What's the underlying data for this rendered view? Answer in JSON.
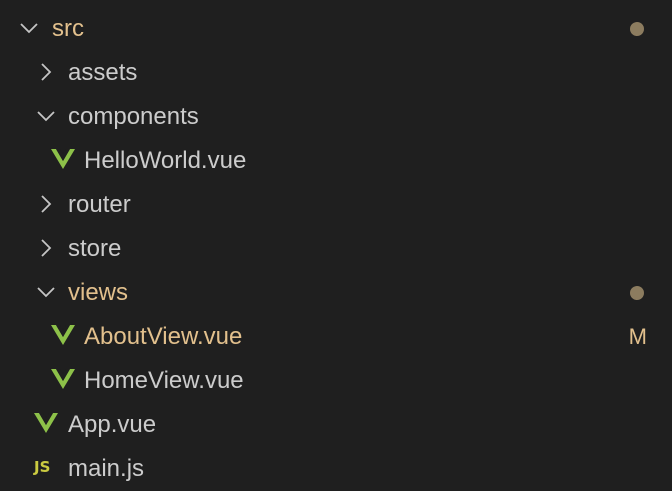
{
  "explorer": {
    "items": [
      {
        "label": "src",
        "kind": "folder",
        "expanded": true,
        "icon": "chevron-down-icon",
        "decoration": "dot"
      },
      {
        "label": "assets",
        "kind": "folder",
        "expanded": false,
        "icon": "chevron-right-icon"
      },
      {
        "label": "components",
        "kind": "folder",
        "expanded": true,
        "icon": "chevron-down-icon"
      },
      {
        "label": "HelloWorld.vue",
        "kind": "file",
        "icon": "vue-file-icon"
      },
      {
        "label": "router",
        "kind": "folder",
        "expanded": false,
        "icon": "chevron-right-icon"
      },
      {
        "label": "store",
        "kind": "folder",
        "expanded": false,
        "icon": "chevron-right-icon"
      },
      {
        "label": "views",
        "kind": "folder",
        "expanded": true,
        "icon": "chevron-down-icon",
        "decoration": "dot"
      },
      {
        "label": "AboutView.vue",
        "kind": "file",
        "icon": "vue-file-icon",
        "badge": "M"
      },
      {
        "label": "HomeView.vue",
        "kind": "file",
        "icon": "vue-file-icon"
      },
      {
        "label": "App.vue",
        "kind": "file",
        "icon": "vue-file-icon"
      },
      {
        "label": "main.js",
        "kind": "file",
        "icon": "js-file-icon",
        "icon_text": "JS"
      }
    ]
  },
  "colors": {
    "background": "#1f1f1f",
    "text": "#cccccc",
    "modified": "#e2c08d",
    "dot": "#8c7c5f",
    "vue": "#8dc149",
    "js": "#cbcb41"
  }
}
